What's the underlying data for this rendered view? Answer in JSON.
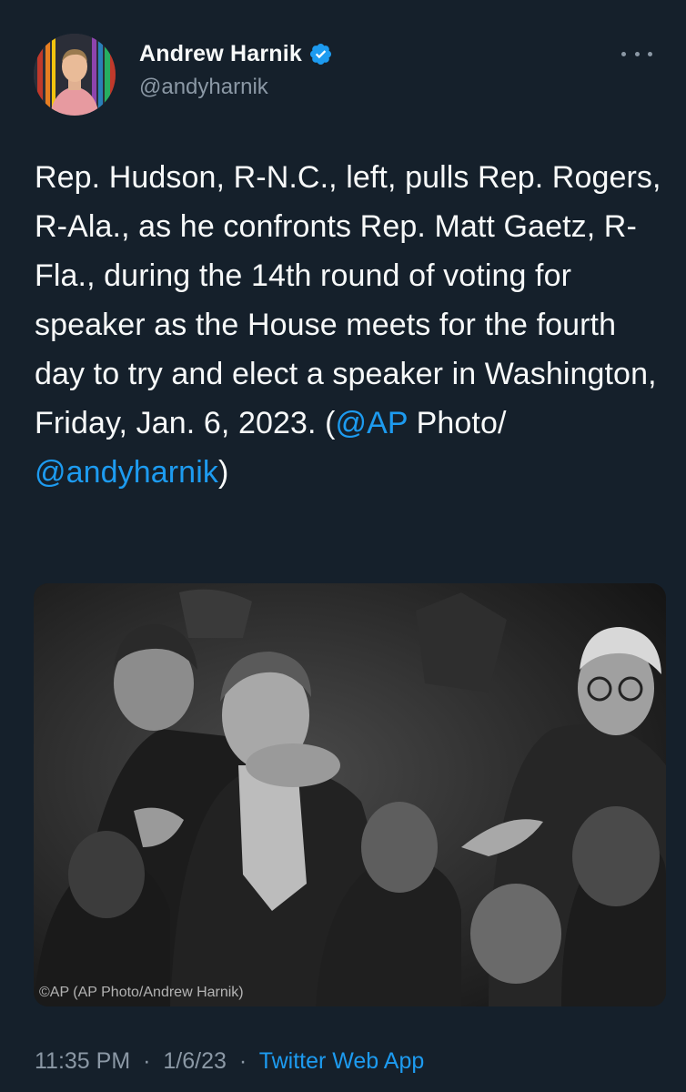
{
  "author": {
    "display_name": "Andrew Harnik",
    "handle": "@andyharnik",
    "verified": true
  },
  "icons": {
    "verified": "verified-badge-icon",
    "more": "more-dots-icon"
  },
  "colors": {
    "background": "#15202b",
    "link": "#1d9bf0",
    "secondary_text": "#8b98a5",
    "primary_text": "#f7f9f9"
  },
  "tweet": {
    "text_main": "Rep. Hudson, R-N.C., left, pulls Rep. Rogers, R-Ala., as he confronts Rep. Matt Gaetz, R-Fla., during the 14th round of voting for speaker as the House meets for the fourth day to try and elect a speaker in Washington, Friday, Jan. 6, 2023. (",
    "mention_ap": "@AP",
    "text_photo": " Photo/",
    "mention_author": "@andyharnik",
    "text_end": ")"
  },
  "photo": {
    "credit": "©AP (AP Photo/Andrew Harnik)"
  },
  "meta": {
    "time": "11:35 PM",
    "separator": "·",
    "date": "1/6/23",
    "source": "Twitter Web App"
  }
}
